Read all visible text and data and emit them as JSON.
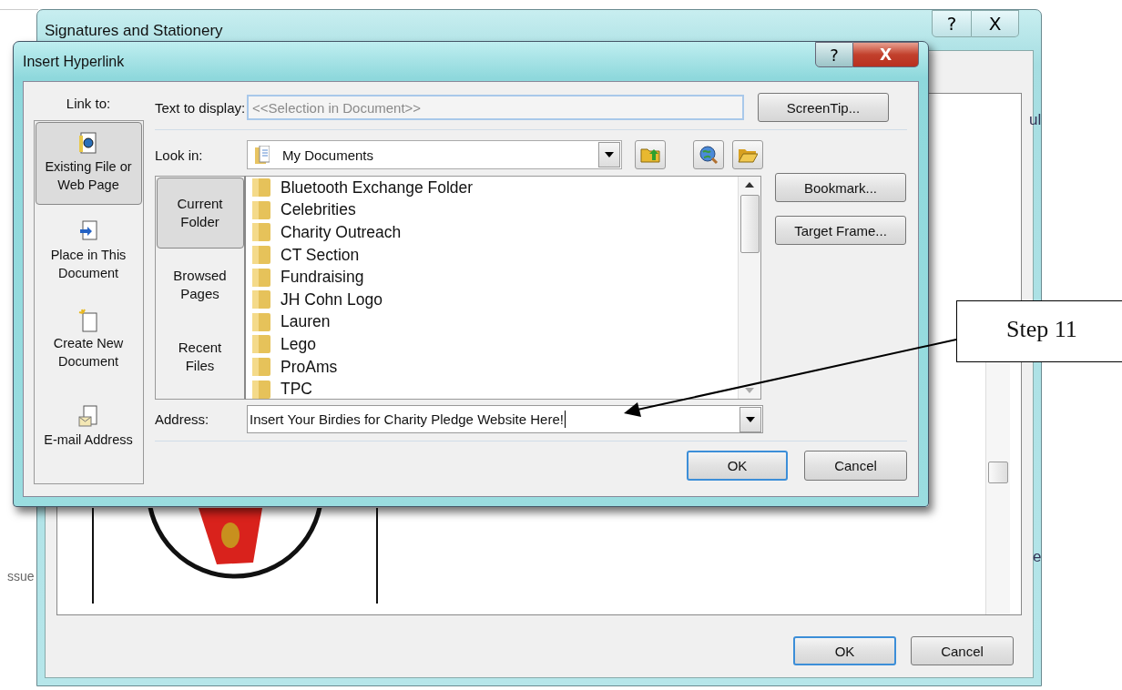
{
  "background_fragments": [
    {
      "text": "ssue",
      "kind": "left"
    },
    {
      "text": "ul",
      "kind": "right-top"
    },
    {
      "text": "e",
      "kind": "right-bottom"
    }
  ],
  "back_window": {
    "title": "Signatures and Stationery",
    "help": "?",
    "close": "X",
    "buttons": [
      {
        "label": "OK",
        "default": true
      },
      {
        "label": "Cancel",
        "default": false
      }
    ]
  },
  "dialog": {
    "title": "Insert Hyperlink",
    "help": "?",
    "close": "X",
    "link_to_label": "Link to:",
    "link_targets": [
      {
        "label": "Existing File or Web Page",
        "kind": "file",
        "selected": true
      },
      {
        "label": "Place in This Document",
        "kind": "place",
        "selected": false
      },
      {
        "label": "Create New Document",
        "kind": "new",
        "selected": false
      },
      {
        "label": "E-mail Address",
        "kind": "mail",
        "selected": false
      }
    ],
    "text_to_display": {
      "label": "Text to display:",
      "value": "<<Selection in Document>>"
    },
    "screentip_button": "ScreenTip...",
    "look_in": {
      "label": "Look in:",
      "value": "My Documents"
    },
    "locations": [
      {
        "label": "Current Folder",
        "selected": true
      },
      {
        "label": "Browsed Pages",
        "selected": false
      },
      {
        "label": "Recent Files",
        "selected": false
      }
    ],
    "files": [
      "Bluetooth Exchange Folder",
      "Celebrities",
      "Charity Outreach",
      "CT Section",
      "Fundraising",
      "JH Cohn Logo",
      "Lauren",
      "Lego",
      "ProAms",
      "TPC"
    ],
    "side_buttons": [
      "Bookmark...",
      "Target Frame..."
    ],
    "address": {
      "label": "Address:",
      "value": "Insert Your Birdies for Charity Pledge Website Here!"
    },
    "buttons": [
      {
        "label": "OK",
        "default": true
      },
      {
        "label": "Cancel",
        "default": false
      }
    ]
  },
  "callout": {
    "text": "Step 11"
  }
}
